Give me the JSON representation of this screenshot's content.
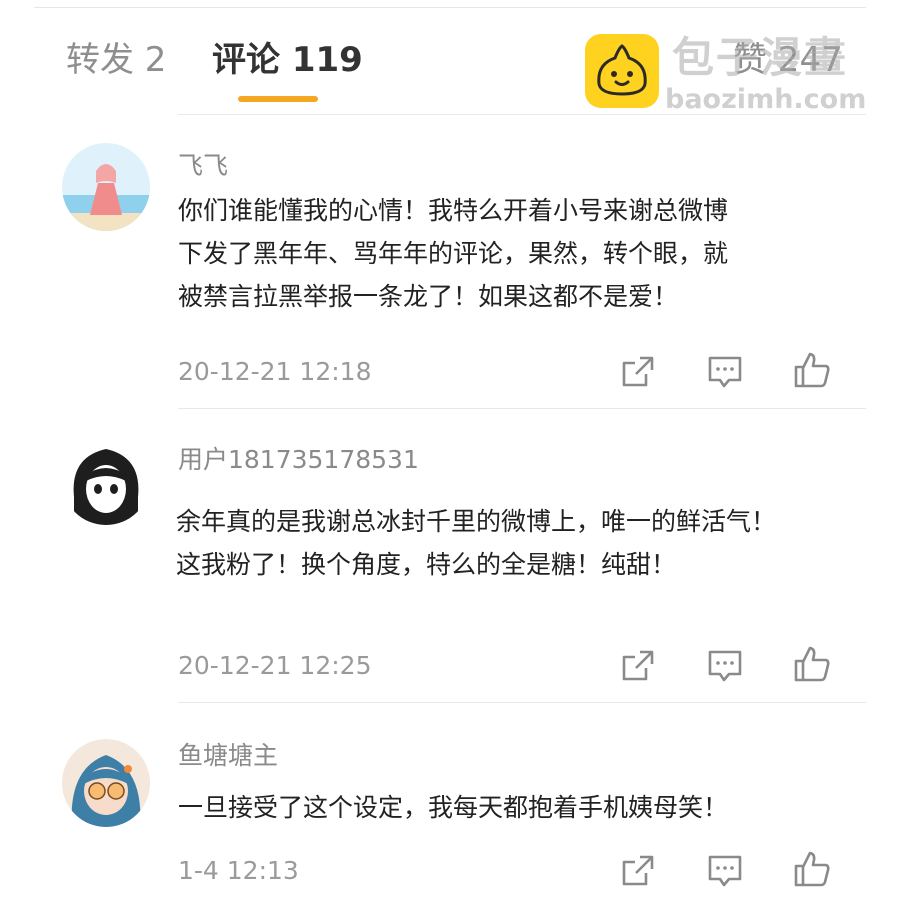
{
  "tabs": {
    "repost": "转发 2",
    "comments": "评论 119",
    "likes": "赞 247"
  },
  "watermark": {
    "text": "包子漫畫",
    "url": "baozimh.com"
  },
  "comments": [
    {
      "username": "飞飞",
      "lines": [
        "你们谁能懂我的心情！我特么开着小号来谢总微博",
        "下发了黑年年、骂年年的评论，果然，转个眼，就",
        "被禁言拉黑举报一条龙了！如果这都不是爱！"
      ],
      "time": "20-12-21 12:18"
    },
    {
      "username": "用户181735178531",
      "lines": [
        "余年真的是我谢总冰封千里的微博上，唯一的鲜活气！",
        "这我粉了！换个角度，特么的全是糖！纯甜！"
      ],
      "time": "20-12-21 12:25"
    },
    {
      "username": "鱼塘塘主",
      "lines": [
        "一旦接受了这个设定，我每天都抱着手机姨母笑！"
      ],
      "time": "1-4 12:13"
    }
  ],
  "icons": {
    "share": "share-icon",
    "comment": "comment-icon",
    "like": "thumbs-up-icon"
  },
  "colors": {
    "accent": "#f5a623",
    "text_primary": "#222222",
    "text_secondary": "#8a8a8a",
    "divider": "#e8e8e8"
  }
}
